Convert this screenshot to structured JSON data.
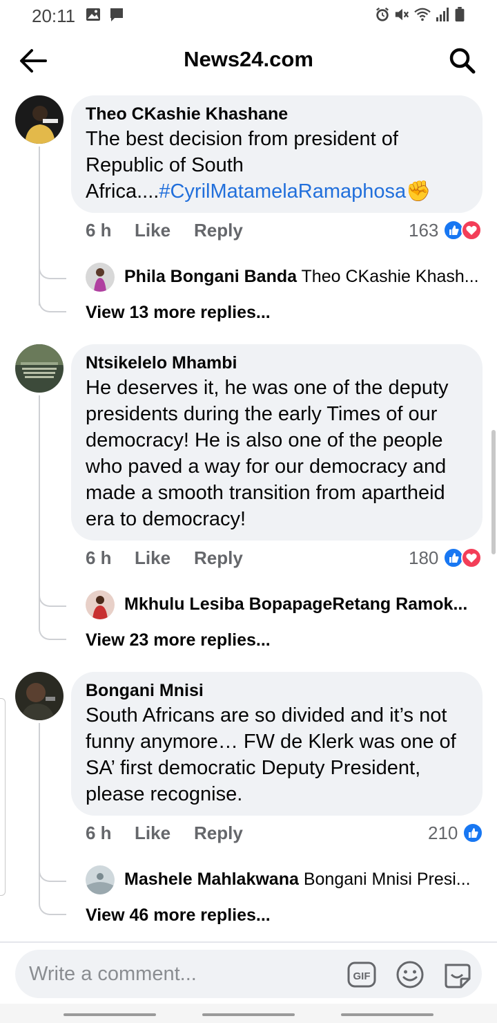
{
  "status_bar": {
    "time": "20:11",
    "left_icons": [
      "image-icon",
      "message-icon"
    ],
    "right_icons": [
      "alarm-icon",
      "mute-icon",
      "wifi-icon",
      "signal-icon",
      "battery-icon"
    ]
  },
  "header": {
    "title": "News24.com",
    "back_icon": "back-arrow-icon",
    "search_icon": "search-icon"
  },
  "comments": [
    {
      "author": "Theo CKashie Khashane",
      "text": "The best decision from  president of Republic of South Africa....",
      "hashtag": "#CyrilMatamelaRamaphosa",
      "emoji": "✊",
      "time": "6 h",
      "like_label": "Like",
      "reply_label": "Reply",
      "reaction_count": "163",
      "reactions": [
        "like",
        "love"
      ],
      "reply_preview": {
        "name": "Phila Bongani Banda",
        "text": "Theo CKashie Khash..."
      },
      "view_more": "View 13 more replies..."
    },
    {
      "author": "Ntsikelelo Mhambi",
      "text": "He deserves it, he was one of the deputy presidents during the early Times of our democracy! He is also one of the people who paved a way for our democracy and made a smooth transition from apartheid era to democracy!",
      "time": "6 h",
      "like_label": "Like",
      "reply_label": "Reply",
      "reaction_count": "180",
      "reactions": [
        "like",
        "love"
      ],
      "avatar_caption": "I keep quiet I don't say much I watch and learn",
      "reply_preview": {
        "name": "Mkhulu Lesiba BopapageRetang Ramok...",
        "text": ""
      },
      "view_more": "View 23 more replies..."
    },
    {
      "author": "Bongani Mnisi",
      "text": "South Africans are so divided and it’s not funny anymore… FW de Klerk was one of SA’ first democratic Deputy President, please recognise.",
      "time": "6 h",
      "like_label": "Like",
      "reply_label": "Reply",
      "reaction_count": "210",
      "reactions": [
        "like"
      ],
      "reply_preview": {
        "name": "Mashele Mahlakwana",
        "text": "Bongani Mnisi Presi..."
      },
      "view_more": "View 46 more replies..."
    }
  ],
  "composer": {
    "placeholder": "Write a comment...",
    "gif_label": "GIF",
    "icons": [
      "gif-icon",
      "emoji-icon",
      "sticker-icon"
    ]
  },
  "colors": {
    "bubble": "#f0f2f5",
    "hashtag": "#216fdb",
    "like_blue": "#1877f2",
    "love_red": "#f33e58",
    "muted": "#65676b"
  }
}
